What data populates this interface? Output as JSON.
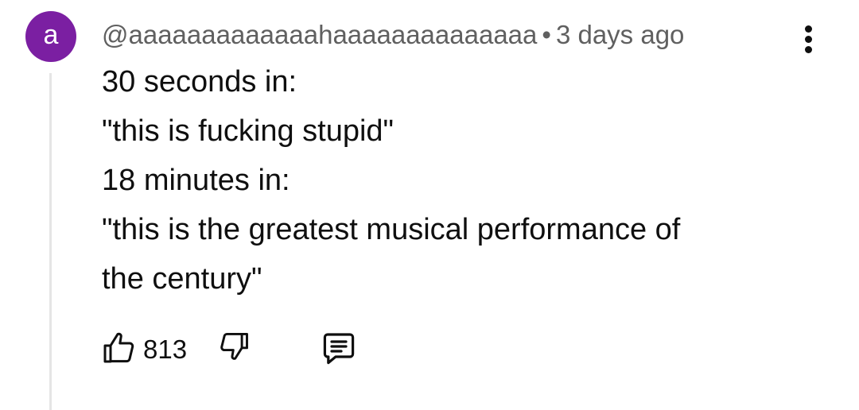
{
  "comment": {
    "avatar_letter": "a",
    "avatar_color": "#7b1fa2",
    "author": "@aaaaaaaaaaaaahaaaaaaaaaaaaaa",
    "separator": "•",
    "timestamp": "3 days ago",
    "lines": [
      "30 seconds in:",
      "\"this is fucking stupid\"",
      "18 minutes in:",
      "\"this is the greatest musical performance of",
      "the century\""
    ],
    "like_count": "813"
  },
  "icons": {
    "like": "thumb-up-icon",
    "dislike": "thumb-down-icon",
    "reply": "comment-icon",
    "menu": "more-vert-icon"
  }
}
